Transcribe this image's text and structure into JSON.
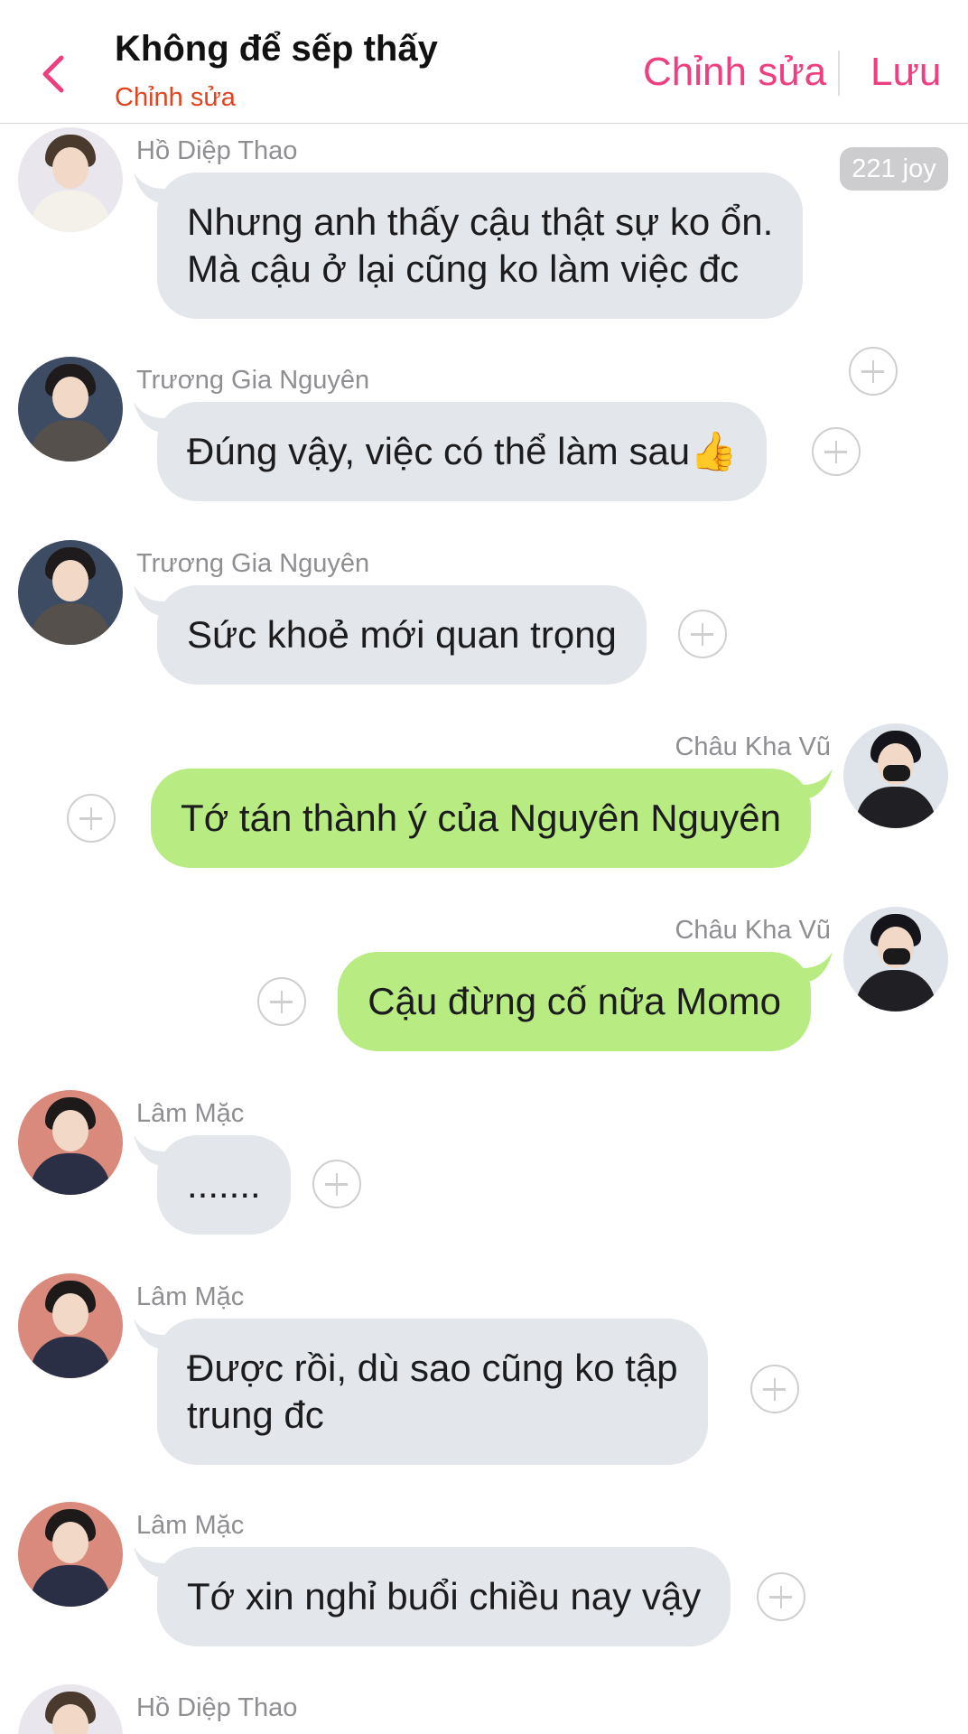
{
  "header": {
    "title": "Không để sếp thấy",
    "subtitle": "Chỉnh sửa",
    "edit_label": "Chỉnh sửa",
    "save_label": "Lưu",
    "back_icon": "chevron-left-icon",
    "accent_color": "#ee3f80",
    "subtitle_color": "#e2431f"
  },
  "joy_badge": "221 joy",
  "colors": {
    "incoming_bubble": "#e3e6ea",
    "outgoing_bubble": "#b8ec82",
    "sender_name": "#8e8e93"
  },
  "messages": [
    {
      "sender": "Hồ Diệp Thao",
      "side": "left",
      "lines": [
        "Nhưng anh thấy cậu thật sự ko ổn.",
        "Mà cậu ở lại cũng ko làm việc đc"
      ]
    },
    {
      "sender": "Trương Gia Nguyên",
      "side": "left",
      "lines": [
        "Đúng vậy, việc có thể làm sau👍"
      ]
    },
    {
      "sender": "Trương Gia Nguyên",
      "side": "left",
      "lines": [
        "Sức khoẻ mới quan trọng"
      ]
    },
    {
      "sender": "Châu Kha Vũ",
      "side": "right",
      "lines": [
        "Tớ tán thành ý của Nguyên Nguyên"
      ]
    },
    {
      "sender": "Châu Kha Vũ",
      "side": "right",
      "lines": [
        "Cậu đừng cố nữa Momo"
      ]
    },
    {
      "sender": "Lâm Mặc",
      "side": "left",
      "lines": [
        "......."
      ]
    },
    {
      "sender": "Lâm Mặc",
      "side": "left",
      "lines": [
        "Được rồi, dù sao cũng ko tập",
        "trung đc"
      ]
    },
    {
      "sender": "Lâm Mặc",
      "side": "left",
      "lines": [
        "Tớ xin nghỉ buổi chiều nay vậy"
      ]
    },
    {
      "sender": "Hồ Diệp Thao",
      "side": "left",
      "lines": []
    }
  ]
}
